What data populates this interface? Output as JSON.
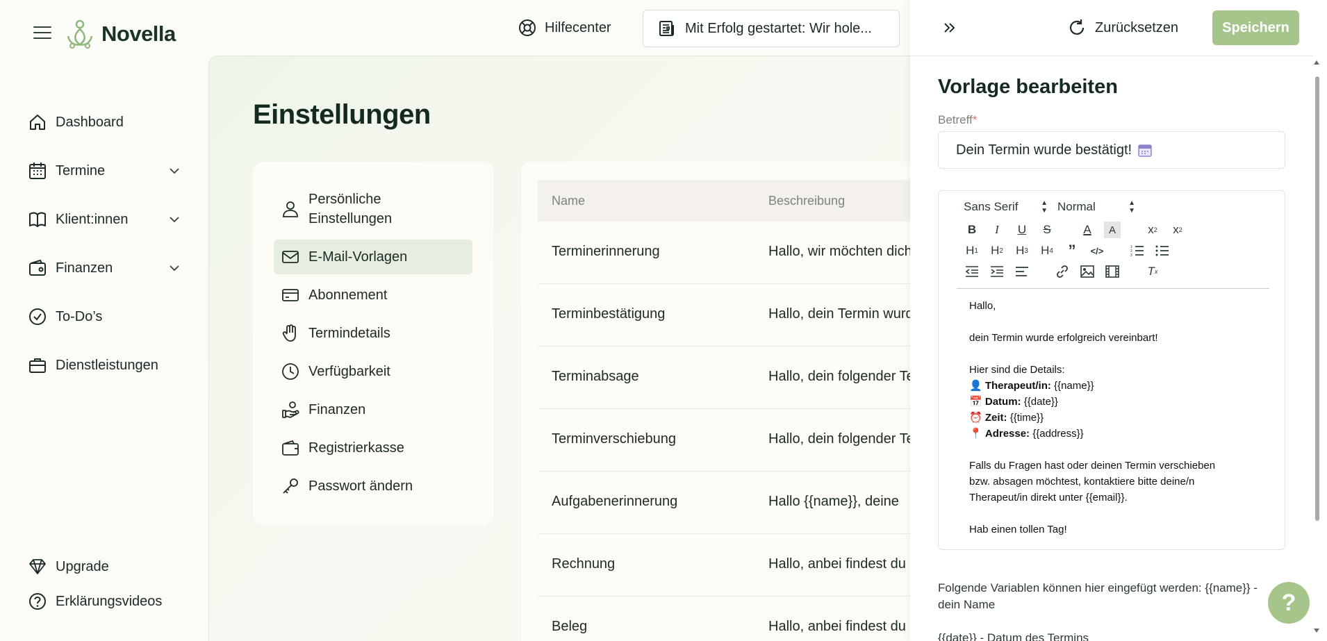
{
  "header": {
    "logo_text": "Novella",
    "help_center": "Hilfecenter",
    "news_banner": "Mit Erfolg gestartet: Wir hole..."
  },
  "sidebar": {
    "items": [
      {
        "label": "Dashboard",
        "icon": "home-icon"
      },
      {
        "label": "Termine",
        "icon": "calendar-icon"
      },
      {
        "label": "Klient:innen",
        "icon": "book-icon"
      },
      {
        "label": "Finanzen",
        "icon": "wallet-icon"
      },
      {
        "label": "To-Do’s",
        "icon": "check-circle-icon"
      },
      {
        "label": "Dienstleistungen",
        "icon": "briefcase-icon"
      }
    ],
    "bottom": [
      {
        "label": "Upgrade",
        "icon": "diamond-icon"
      },
      {
        "label": "Erklärungsvideos",
        "icon": "help-circle-icon"
      }
    ]
  },
  "main": {
    "title": "Einstellungen",
    "menu": [
      {
        "label": "Persönliche Einstellungen",
        "icon": "user-icon"
      },
      {
        "label": "E-Mail-Vorlagen",
        "icon": "mail-icon",
        "active": true
      },
      {
        "label": "Abonnement",
        "icon": "credit-card-icon"
      },
      {
        "label": "Termindetails",
        "icon": "hand-icon"
      },
      {
        "label": "Verfügbarkeit",
        "icon": "clock-icon"
      },
      {
        "label": "Finanzen",
        "icon": "hand-coins-icon"
      },
      {
        "label": "Registrierkasse",
        "icon": "wallet-icon"
      },
      {
        "label": "Passwort ändern",
        "icon": "key-icon"
      }
    ],
    "table": {
      "headers": [
        "Name",
        "Beschreibung"
      ],
      "rows": [
        {
          "name": "Terminerinnerung",
          "desc": "Hallo,  wir möchten dich"
        },
        {
          "name": "Terminbestätigung",
          "desc": "Hallo,  dein Termin wurde"
        },
        {
          "name": "Terminabsage",
          "desc": "Hallo,  dein folgender Termin"
        },
        {
          "name": "Terminverschiebung",
          "desc": "Hallo,  dein folgender Termin"
        },
        {
          "name": "Aufgabenerinnerung",
          "desc": "Hallo {{name}},  deine"
        },
        {
          "name": "Rechnung",
          "desc": "Hallo,  anbei findest du"
        },
        {
          "name": "Beleg",
          "desc": "Hallo,  anbei findest du"
        }
      ]
    }
  },
  "drawer": {
    "reset_label": "Zurücksetzen",
    "save_label": "Speichern",
    "title": "Vorlage bearbeiten",
    "subject_label": "Betreff",
    "subject_required": "*",
    "subject_value": "Dein Termin wurde bestätigt!",
    "toolbar": {
      "font": "Sans Serif",
      "size": "Normal"
    },
    "body": {
      "greeting": "Hallo,",
      "line1": "dein Termin wurde erfolgreich vereinbart!",
      "details_intro": "Hier sind die Details:",
      "details": [
        {
          "emoji": "👤",
          "label": "Therapeut/in:",
          "value": "{{name}}"
        },
        {
          "emoji": "📅",
          "label": "Datum:",
          "value": "{{date}}"
        },
        {
          "emoji": "⏰",
          "label": "Zeit:",
          "value": "{{time}}"
        },
        {
          "emoji": "📍",
          "label": "Adresse:",
          "value": "{{address}}"
        }
      ],
      "contact_1": "Falls du Fragen hast oder deinen Termin verschieben",
      "contact_2": "bzw. absagen möchtest, kontaktiere bitte deine/n",
      "contact_3": "Therapeut/in direkt unter {{email}}.",
      "closing": "Hab einen tollen Tag!"
    },
    "variables": {
      "intro": "Folgende Variablen können hier eingefügt werden: {{name}} -",
      "name_desc": "dein Name",
      "date_line": "{{date}} - Datum des Termins"
    }
  },
  "help_fab": "?",
  "colors": {
    "accent": "#a6c58a",
    "active_bg": "#e6eedf",
    "text": "#1b2b24"
  }
}
